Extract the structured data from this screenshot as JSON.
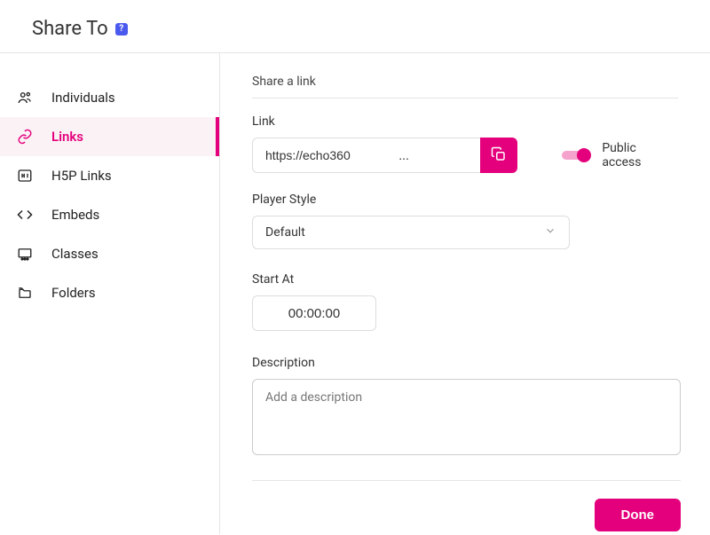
{
  "header": {
    "title": "Share To",
    "help_icon": "?"
  },
  "sidebar": {
    "items": [
      {
        "label": "Individuals",
        "icon": "people-icon",
        "active": false
      },
      {
        "label": "Links",
        "icon": "link-icon",
        "active": true
      },
      {
        "label": "H5P Links",
        "icon": "h5p-icon",
        "active": false
      },
      {
        "label": "Embeds",
        "icon": "code-icon",
        "active": false
      },
      {
        "label": "Classes",
        "icon": "classes-icon",
        "active": false
      },
      {
        "label": "Folders",
        "icon": "folder-icon",
        "active": false
      }
    ]
  },
  "main": {
    "section_title": "Share a link",
    "link": {
      "label": "Link",
      "value": "https://echo360              ..."
    },
    "public_access": {
      "label": "Public access",
      "enabled": true
    },
    "player_style": {
      "label": "Player Style",
      "value": "Default"
    },
    "start_at": {
      "label": "Start At",
      "value": "00:00:00"
    },
    "description": {
      "label": "Description",
      "placeholder": "Add a description",
      "value": ""
    },
    "done_label": "Done"
  }
}
